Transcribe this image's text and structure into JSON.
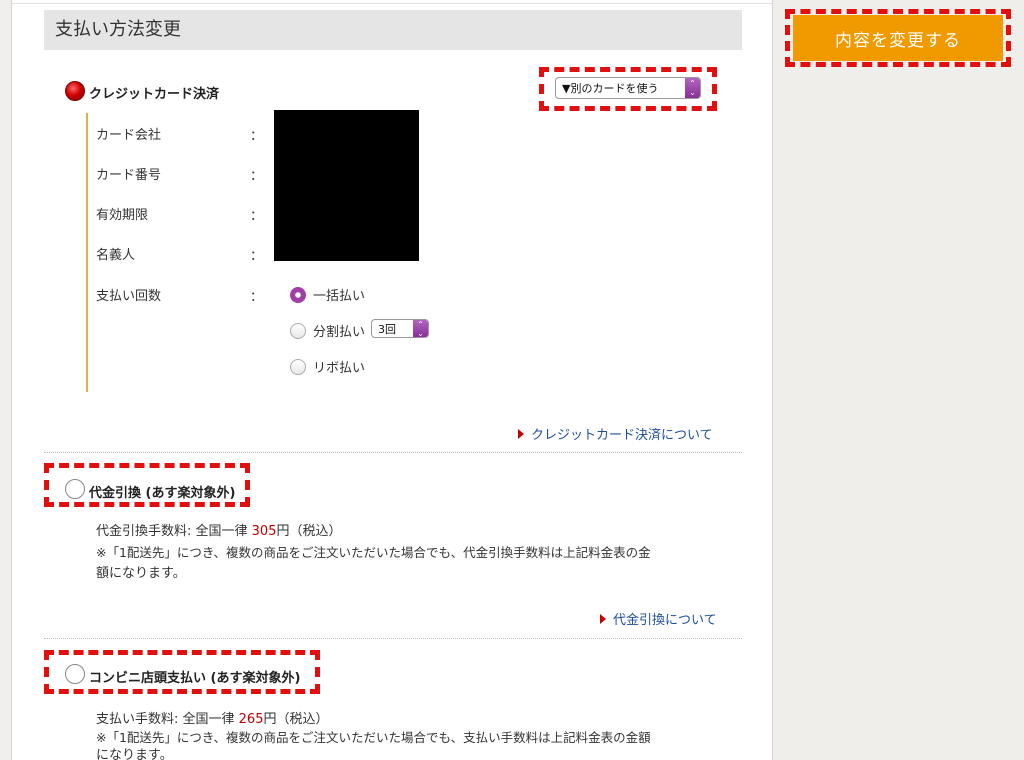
{
  "header": {
    "title": "支払い方法変更"
  },
  "submit_button": {
    "label": "内容を変更する"
  },
  "credit": {
    "label": "クレジットカード決済",
    "selected": true,
    "card_select": {
      "value": "▼別のカードを使う"
    },
    "fields": [
      {
        "label": "カード会社",
        "colon": "："
      },
      {
        "label": "カード番号",
        "colon": "："
      },
      {
        "label": "有効期限",
        "colon": "："
      },
      {
        "label": "名義人",
        "colon": "："
      }
    ],
    "installments": {
      "label": "支払い回数",
      "colon": "：",
      "options": [
        {
          "label": "一括払い",
          "selected": true
        },
        {
          "label": "分割払い",
          "selected": false
        },
        {
          "label": "リボ払い",
          "selected": false
        }
      ],
      "count_select": {
        "value": "3回"
      }
    },
    "info_link": "クレジットカード決済について"
  },
  "cod": {
    "label": "代金引換 (あす楽対象外)",
    "fee_prefix": "代金引換手数料: 全国一律 ",
    "fee_amount": "305",
    "fee_suffix": "円（税込）",
    "note_line1": "※「1配送先」につき、複数の商品をご注文いただいた場合でも、代金引換手数料は上記料金表の金",
    "note_line2": "額になります。",
    "info_link": "代金引換について"
  },
  "convenience": {
    "label": "コンビニ店頭支払い (あす楽対象外)",
    "fee_prefix": "支払い手数料: 全国一律 ",
    "fee_amount": "265",
    "fee_suffix": "円（税込）",
    "note_line1": "※「1配送先」につき、複数の商品をご注文いただいた場合でも、支払い手数料は上記料金表の金額",
    "note_line2": "になります。"
  },
  "colors": {
    "accent_orange": "#f19a00",
    "highlight_red": "#e20f0f",
    "link_blue": "#1f4e9a",
    "radio_purple": "#a13fa7"
  }
}
